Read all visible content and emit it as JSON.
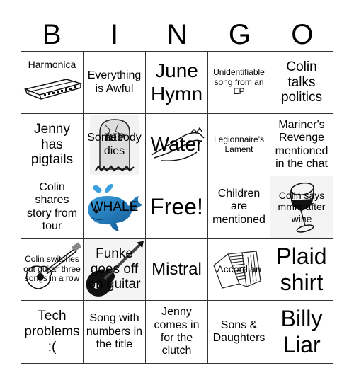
{
  "header": {
    "letters": [
      "B",
      "I",
      "N",
      "G",
      "O"
    ]
  },
  "cells": [
    {
      "text": "Harmonica",
      "icon": "harmonica-icon"
    },
    {
      "text": "Everything is Awful"
    },
    {
      "text": "June Hymn"
    },
    {
      "text": "Unidentifiable song from an EP"
    },
    {
      "text": "Colin talks politics"
    },
    {
      "text": "Jenny has pigtails"
    },
    {
      "text": "Somebody dies",
      "icon": "tombstone-icon"
    },
    {
      "text": "Water",
      "icon": "wave-icon"
    },
    {
      "text": "Legionnaire's Lament"
    },
    {
      "text": "Mariner's Revenge mentioned in the chat"
    },
    {
      "text": "Colin shares story from tour"
    },
    {
      "text": "WHALE",
      "icon": "whale-icon"
    },
    {
      "text": "Free!"
    },
    {
      "text": "Children are mentioned"
    },
    {
      "text": "Colin says mmm after wine",
      "icon": "wine-glass-icon"
    },
    {
      "text": "Colin switches out guitar three songs in a row",
      "icon": "acoustic-guitar-icon"
    },
    {
      "text": "Funke goes off on guitar",
      "icon": "electric-guitar-icon"
    },
    {
      "text": "Mistral"
    },
    {
      "text": "Accordian",
      "icon": "accordion-icon"
    },
    {
      "text": "Plaid shirt"
    },
    {
      "text": "Tech problems :("
    },
    {
      "text": "Song with numbers in the title"
    },
    {
      "text": "Jenny comes in for the clutch"
    },
    {
      "text": "Sons & Daughters"
    },
    {
      "text": "Billy Liar"
    }
  ],
  "colors": {
    "whale": "#1e7fc2",
    "grid_line": "#333333"
  }
}
